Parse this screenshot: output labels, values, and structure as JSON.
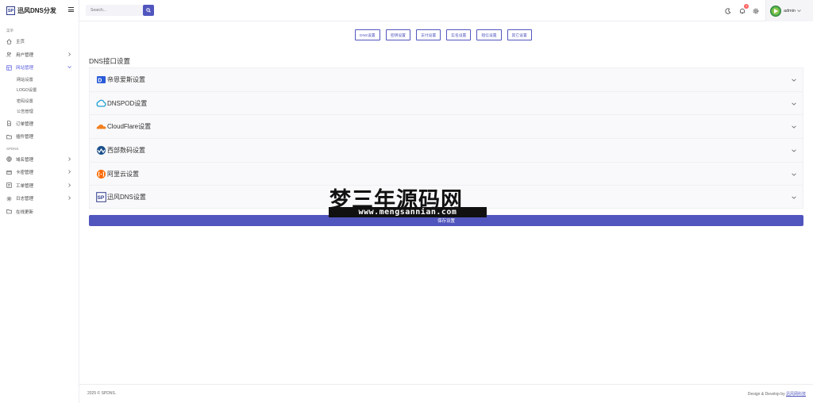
{
  "brand": {
    "logo_text": "SP",
    "name": "迅风DNS分发"
  },
  "sidebar": {
    "section1": "菜单",
    "items1": [
      {
        "label": "主页",
        "icon": "home-icon"
      },
      {
        "label": "用户管理",
        "icon": "users-icon",
        "expandable": true
      },
      {
        "label": "网站管理",
        "icon": "layout-icon",
        "expandable": true,
        "expanded": true
      }
    ],
    "subitems": [
      "网站设置",
      "LOGO设置",
      "密码设置",
      "公告管理"
    ],
    "items2": [
      {
        "label": "订单管理",
        "icon": "file-icon"
      },
      {
        "label": "插件管理",
        "icon": "folder-icon"
      }
    ],
    "section2": "SPDNS",
    "items3": [
      {
        "label": "域名管理",
        "icon": "globe-icon",
        "expandable": true
      },
      {
        "label": "卡密管理",
        "icon": "card-icon",
        "expandable": true
      },
      {
        "label": "工单管理",
        "icon": "ticket-icon",
        "expandable": true
      },
      {
        "label": "日志管理",
        "icon": "settings-icon",
        "expandable": true
      },
      {
        "label": "在线更新",
        "icon": "folder-icon"
      }
    ]
  },
  "topbar": {
    "search_placeholder": "Search...",
    "notification_count": "3",
    "user_name": "admin"
  },
  "tabs": [
    "DNS设置",
    "密钥设置",
    "支付设置",
    "实名设置",
    "短信设置",
    "其它设置"
  ],
  "main": {
    "heading": "DNS接口设置",
    "providers": [
      {
        "title": "帝恩爱斯设置",
        "logo": "dnsla-logo"
      },
      {
        "title": "DNSPOD设置",
        "logo": "dnspod-logo"
      },
      {
        "title": "CloudFlare设置",
        "logo": "cloudflare-logo"
      },
      {
        "title": "西部数码设置",
        "logo": "west-logo"
      },
      {
        "title": "阿里云设置",
        "logo": "aliyun-logo"
      },
      {
        "title": "迅风DNS设置",
        "logo": "spdns-logo"
      }
    ],
    "save_label": "保存设置"
  },
  "watermark": {
    "title": "梦三年源码网",
    "url": "www.mengsannian.com"
  },
  "footer": {
    "copyright": "2025 © SPDNS.",
    "credit_prefix": "Design & Develop by ",
    "credit_link": "迅风网科技"
  },
  "colors": {
    "primary": "#5156be",
    "badge": "#fd625e"
  }
}
